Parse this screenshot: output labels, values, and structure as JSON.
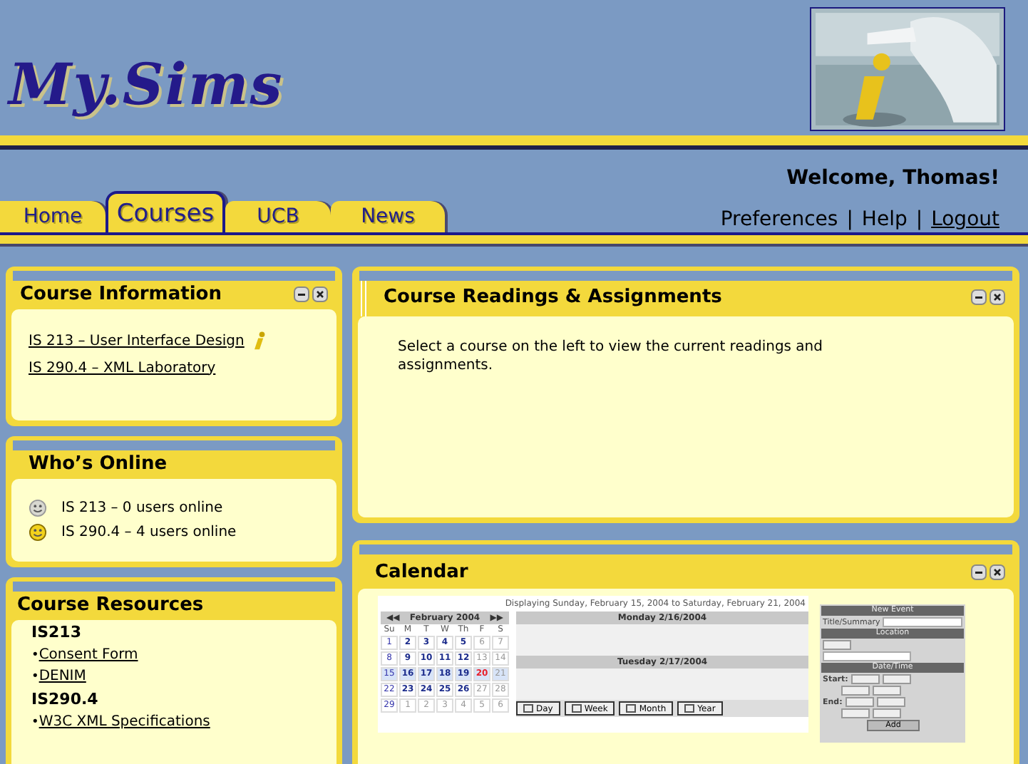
{
  "header": {
    "logo": "My.Sims",
    "welcome": "Welcome, Thomas!",
    "links": [
      {
        "label": "Preferences",
        "underlined": false
      },
      {
        "label": "Help",
        "underlined": false
      },
      {
        "label": "Logout",
        "underlined": true
      }
    ],
    "separator": "|"
  },
  "tabs": [
    {
      "label": "Home",
      "selected": false
    },
    {
      "label": "Courses",
      "selected": true
    },
    {
      "label": "UCB",
      "selected": false
    },
    {
      "label": "News",
      "selected": false
    }
  ],
  "course_information": {
    "title": "Course Information",
    "controls": true,
    "courses": [
      {
        "label": "IS 213 – User Interface Design",
        "info": true
      },
      {
        "label": "IS 290.4 – XML Laboratory",
        "info": false
      }
    ]
  },
  "whos_online": {
    "title": "Who’s Online",
    "controls": false,
    "entries": [
      {
        "label": "IS 213 – 0 users online",
        "active": false
      },
      {
        "label": "IS 290.4 – 4 users online",
        "active": true
      }
    ]
  },
  "course_resources": {
    "title": "Course Resources",
    "controls": false,
    "items": [
      {
        "kind": "heading",
        "label": "IS213"
      },
      {
        "kind": "link",
        "label": "Consent Form"
      },
      {
        "kind": "link",
        "label": "DENIM"
      },
      {
        "kind": "heading",
        "label": "IS290.4"
      },
      {
        "kind": "link",
        "label": "W3C XML Specifications"
      }
    ],
    "bullet": "•"
  },
  "readings": {
    "title": "Course Readings & Assignments",
    "controls": true,
    "message": "Select a course on the left to view the current readings and assignments."
  },
  "calendar": {
    "title": "Calendar",
    "controls": true,
    "range": "Displaying Sunday, February 15, 2004 to Saturday, February 21, 2004",
    "month": {
      "prev": "◀◀",
      "label": "February 2004",
      "next": "▶▶",
      "weekdays": [
        "Su",
        "M",
        "T",
        "W",
        "Th",
        "F",
        "S"
      ],
      "weeks": [
        {
          "selected": false,
          "days": [
            {
              "label": "1",
              "kind": "plain"
            },
            {
              "label": "2",
              "kind": "bold"
            },
            {
              "label": "3",
              "kind": "bold"
            },
            {
              "label": "4",
              "kind": "bold"
            },
            {
              "label": "5",
              "kind": "bold"
            },
            {
              "label": "6",
              "kind": "muted"
            },
            {
              "label": "7",
              "kind": "muted"
            }
          ]
        },
        {
          "selected": false,
          "days": [
            {
              "label": "8",
              "kind": "plain"
            },
            {
              "label": "9",
              "kind": "bold"
            },
            {
              "label": "10",
              "kind": "bold"
            },
            {
              "label": "11",
              "kind": "bold"
            },
            {
              "label": "12",
              "kind": "bold"
            },
            {
              "label": "13",
              "kind": "muted"
            },
            {
              "label": "14",
              "kind": "muted"
            }
          ]
        },
        {
          "selected": true,
          "days": [
            {
              "label": "15",
              "kind": "plain"
            },
            {
              "label": "16",
              "kind": "bold"
            },
            {
              "label": "17",
              "kind": "bold"
            },
            {
              "label": "18",
              "kind": "bold"
            },
            {
              "label": "19",
              "kind": "bold"
            },
            {
              "label": "20",
              "kind": "today"
            },
            {
              "label": "21",
              "kind": "muted"
            }
          ]
        },
        {
          "selected": false,
          "days": [
            {
              "label": "22",
              "kind": "plain"
            },
            {
              "label": "23",
              "kind": "bold"
            },
            {
              "label": "24",
              "kind": "bold"
            },
            {
              "label": "25",
              "kind": "bold"
            },
            {
              "label": "26",
              "kind": "bold"
            },
            {
              "label": "27",
              "kind": "muted"
            },
            {
              "label": "28",
              "kind": "muted"
            }
          ]
        },
        {
          "selected": false,
          "days": [
            {
              "label": "29",
              "kind": "plain"
            },
            {
              "label": "1",
              "kind": "muted"
            },
            {
              "label": "2",
              "kind": "muted"
            },
            {
              "label": "3",
              "kind": "muted"
            },
            {
              "label": "4",
              "kind": "muted"
            },
            {
              "label": "5",
              "kind": "muted"
            },
            {
              "label": "6",
              "kind": "muted"
            }
          ]
        }
      ]
    },
    "days": [
      "Monday 2/16/2004",
      "Tuesday 2/17/2004"
    ],
    "views": [
      "Day",
      "Week",
      "Month",
      "Year"
    ],
    "new_event": {
      "title": "New Event",
      "fields": [
        {
          "kind": "section",
          "label": "Location"
        },
        {
          "kind": "section",
          "label": "Date/Time"
        }
      ],
      "summary_label": "Title/Summary",
      "start_label": "Start:",
      "end_label": "End:",
      "add": "Add"
    }
  }
}
